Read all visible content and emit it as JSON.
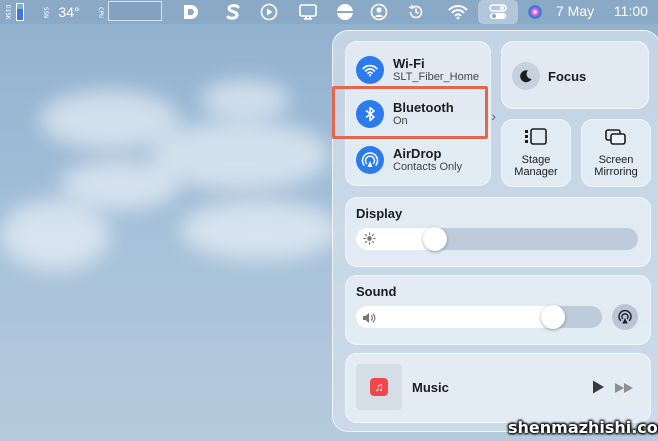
{
  "menubar": {
    "indicator_a": "DISK",
    "indicator_b": "SSN",
    "temperature": "34°",
    "indicator_c": "CPU",
    "date": "7 May",
    "time": "11:00"
  },
  "control_center": {
    "wifi": {
      "title": "Wi-Fi",
      "subtitle": "SLT_Fiber_Home"
    },
    "bluetooth": {
      "title": "Bluetooth",
      "subtitle": "On"
    },
    "airdrop": {
      "title": "AirDrop",
      "subtitle": "Contacts Only"
    },
    "focus": {
      "label": "Focus"
    },
    "stage_manager": {
      "line1": "Stage",
      "line2": "Manager"
    },
    "screen_mirroring": {
      "line1": "Screen",
      "line2": "Mirroring"
    },
    "display": {
      "title": "Display",
      "level": 0.28
    },
    "sound": {
      "title": "Sound",
      "level": 0.8
    },
    "music": {
      "label": "Music"
    }
  },
  "watermark": "shenmazhishi.com",
  "colors": {
    "accent": "#2b7bef",
    "highlight": "#e5664f",
    "music_red": "#f0474f"
  }
}
